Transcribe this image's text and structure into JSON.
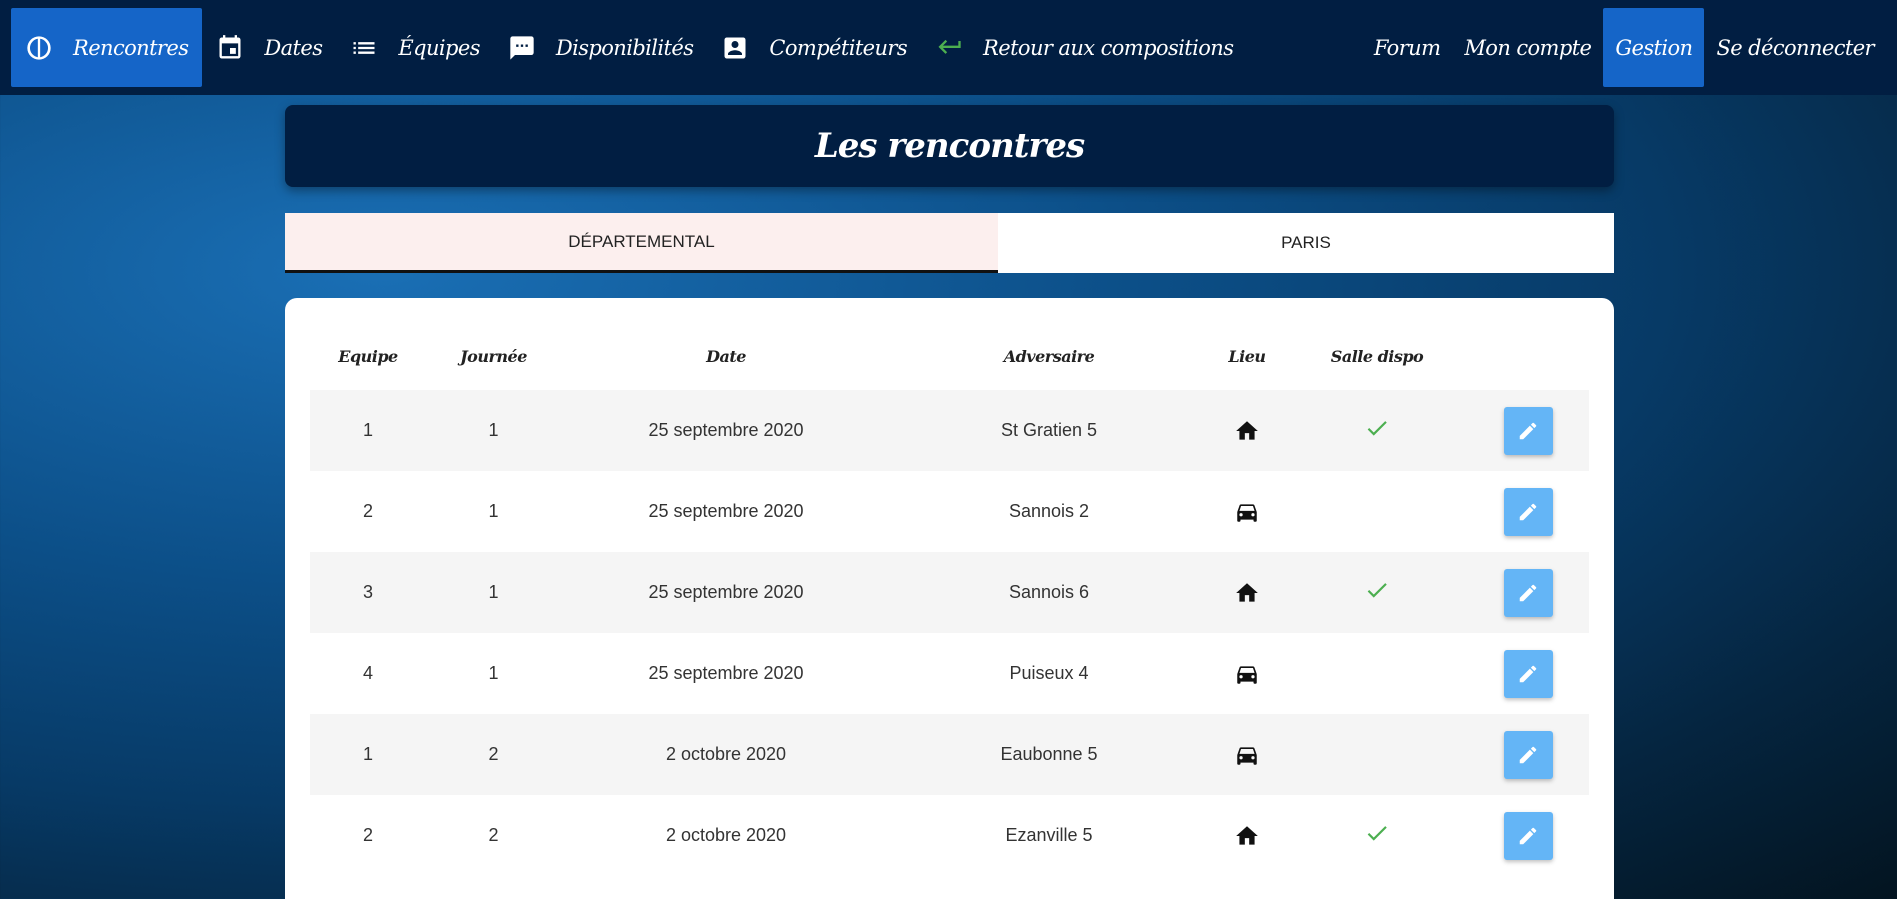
{
  "nav": {
    "left": [
      {
        "label": "Rencontres",
        "icon": "contrast-icon",
        "active": true
      },
      {
        "label": "Dates",
        "icon": "calendar-icon"
      },
      {
        "label": "Équipes",
        "icon": "list-icon"
      },
      {
        "label": "Disponibilités",
        "icon": "comment-icon"
      },
      {
        "label": "Compétiteurs",
        "icon": "contact-card-icon"
      },
      {
        "label": "Retour aux compositions",
        "icon": "return-arrow-icon"
      }
    ],
    "right": [
      {
        "label": "Forum"
      },
      {
        "label": "Mon compte"
      },
      {
        "label": "Gestion",
        "active": true
      },
      {
        "label": "Se déconnecter"
      }
    ]
  },
  "page": {
    "title": "Les rencontres"
  },
  "tabs": [
    {
      "label": "DÉPARTEMENTAL",
      "active": true
    },
    {
      "label": "PARIS"
    }
  ],
  "table": {
    "headers": [
      "Equipe",
      "Journée",
      "Date",
      "Adversaire",
      "Lieu",
      "Salle dispo"
    ],
    "rows": [
      {
        "equipe": "1",
        "journee": "1",
        "date": "25 septembre 2020",
        "adversaire": "St Gratien 5",
        "lieu": "home-icon",
        "salle_dispo": true
      },
      {
        "equipe": "2",
        "journee": "1",
        "date": "25 septembre 2020",
        "adversaire": "Sannois 2",
        "lieu": "car-icon",
        "salle_dispo": false
      },
      {
        "equipe": "3",
        "journee": "1",
        "date": "25 septembre 2020",
        "adversaire": "Sannois 6",
        "lieu": "home-icon",
        "salle_dispo": true
      },
      {
        "equipe": "4",
        "journee": "1",
        "date": "25 septembre 2020",
        "adversaire": "Puiseux 4",
        "lieu": "car-icon",
        "salle_dispo": false
      },
      {
        "equipe": "1",
        "journee": "2",
        "date": "2 octobre 2020",
        "adversaire": "Eaubonne 5",
        "lieu": "car-icon",
        "salle_dispo": false
      },
      {
        "equipe": "2",
        "journee": "2",
        "date": "2 octobre 2020",
        "adversaire": "Ezanville 5",
        "lieu": "home-icon",
        "salle_dispo": true
      }
    ]
  },
  "colors": {
    "navbar": "#011e42",
    "active": "#1565c8",
    "edit_button": "#64b5f6",
    "check": "#4caf50"
  }
}
